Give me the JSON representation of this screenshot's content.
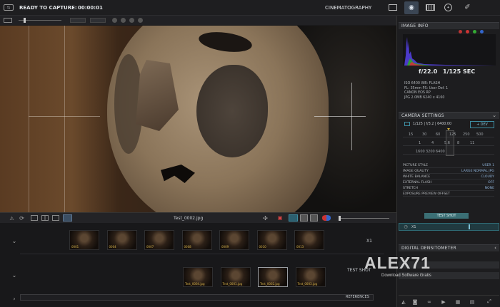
{
  "topbar": {
    "status": "READY TO CAPTURE:",
    "timer": "00:00:01",
    "mode": "CINEMATOGRAPHY"
  },
  "viewer": {
    "filename": "Test_0002.jpg"
  },
  "image_info": {
    "title": "IMAGE INFO",
    "aperture": "f/22.0",
    "shutter": "1/125 SEC",
    "lines": [
      "ISO 6400   WB: FLASH",
      "FL: 35mm   PS: User Def. 1",
      "CANON EOS RP",
      "JPG 2.0MB  6240 x 4160"
    ]
  },
  "camera_settings": {
    "title": "CAMERA SETTINGS",
    "exposure": "1/125 | f/3.2 | 6400:00",
    "dev_btn": "+ DEV",
    "shutter_row": [
      "15",
      "30",
      "60",
      "125",
      "250",
      "500"
    ],
    "aperture_row": [
      "1",
      "4",
      "5.6",
      "8",
      "11"
    ],
    "iso_row": [
      "1600",
      "3200",
      "6400"
    ],
    "rows": [
      {
        "label": "PICTURE STYLE",
        "value": "USER 1"
      },
      {
        "label": "IMAGE QUALITY",
        "value": "LARGE NORMAL JPG"
      },
      {
        "label": "WHITE BALANCE",
        "value": "CLOUDY"
      },
      {
        "label": "EXTERNAL FLASH",
        "value": "OFF"
      },
      {
        "label": "STRETCH",
        "value": "NONE"
      },
      {
        "label": "EXPOSURE PREVIEW OFFSET",
        "value": ""
      }
    ],
    "test_shot": "TEST SHOT",
    "x1": "X1"
  },
  "densitometer": {
    "title": "DIGITAL DENSITOMETER"
  },
  "timeline": {
    "track1": {
      "label": "X1",
      "thumbs": [
        "0001",
        "0004",
        "0007",
        "0008",
        "0009",
        "0010",
        "0013"
      ]
    },
    "track2": {
      "label": "TEST SHOT",
      "thumbs": [
        "Test_0004.jpg",
        "Test_0001.jpg",
        "Test_0002.jpg",
        "Test_0003.jpg"
      ]
    },
    "references": "REFERENCES"
  },
  "watermark": {
    "main": "ALEX71",
    "sub": "Download Software Gratis"
  }
}
